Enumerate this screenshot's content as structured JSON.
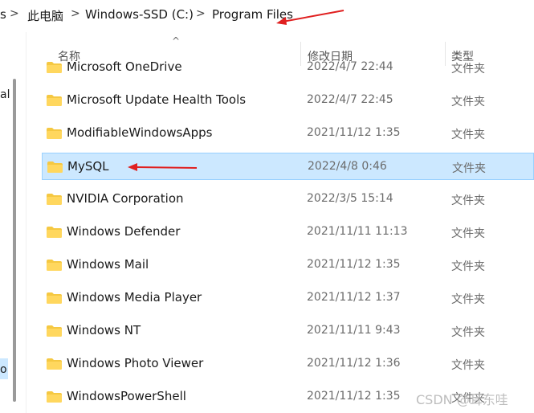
{
  "breadcrumb": {
    "items": [
      "此电脑",
      "Windows-SSD (C:)",
      "Program Files"
    ],
    "separator": ">",
    "left_fragment": "s"
  },
  "columns": {
    "name": "名称",
    "modified": "修改日期",
    "type": "类型"
  },
  "nav": {
    "glyph_1": "al",
    "glyph_2": "o"
  },
  "rows": [
    {
      "name": "Microsoft OneDrive",
      "date": "2022/4/7 22:44",
      "type": "文件夹"
    },
    {
      "name": "Microsoft Update Health Tools",
      "date": "2022/4/7 22:45",
      "type": "文件夹"
    },
    {
      "name": "ModifiableWindowsApps",
      "date": "2021/11/12 1:35",
      "type": "文件夹"
    },
    {
      "name": "MySQL",
      "date": "2022/4/8 0:46",
      "type": "文件夹",
      "selected": true
    },
    {
      "name": "NVIDIA Corporation",
      "date": "2022/3/5 15:14",
      "type": "文件夹"
    },
    {
      "name": "Windows Defender",
      "date": "2021/11/11 11:13",
      "type": "文件夹"
    },
    {
      "name": "Windows Mail",
      "date": "2021/11/12 1:35",
      "type": "文件夹"
    },
    {
      "name": "Windows Media Player",
      "date": "2021/11/12 1:37",
      "type": "文件夹"
    },
    {
      "name": "Windows NT",
      "date": "2021/11/11 9:43",
      "type": "文件夹"
    },
    {
      "name": "Windows Photo Viewer",
      "date": "2021/11/12 1:36",
      "type": "文件夹"
    },
    {
      "name": "WindowsPowerShell",
      "date": "2021/11/12 1:35",
      "type": "文件夹"
    }
  ],
  "watermark": "CSDN @耳东哇",
  "colors": {
    "selection": "#cce8ff",
    "folder": "#f5c842",
    "annotation_arrow": "#e02020"
  }
}
